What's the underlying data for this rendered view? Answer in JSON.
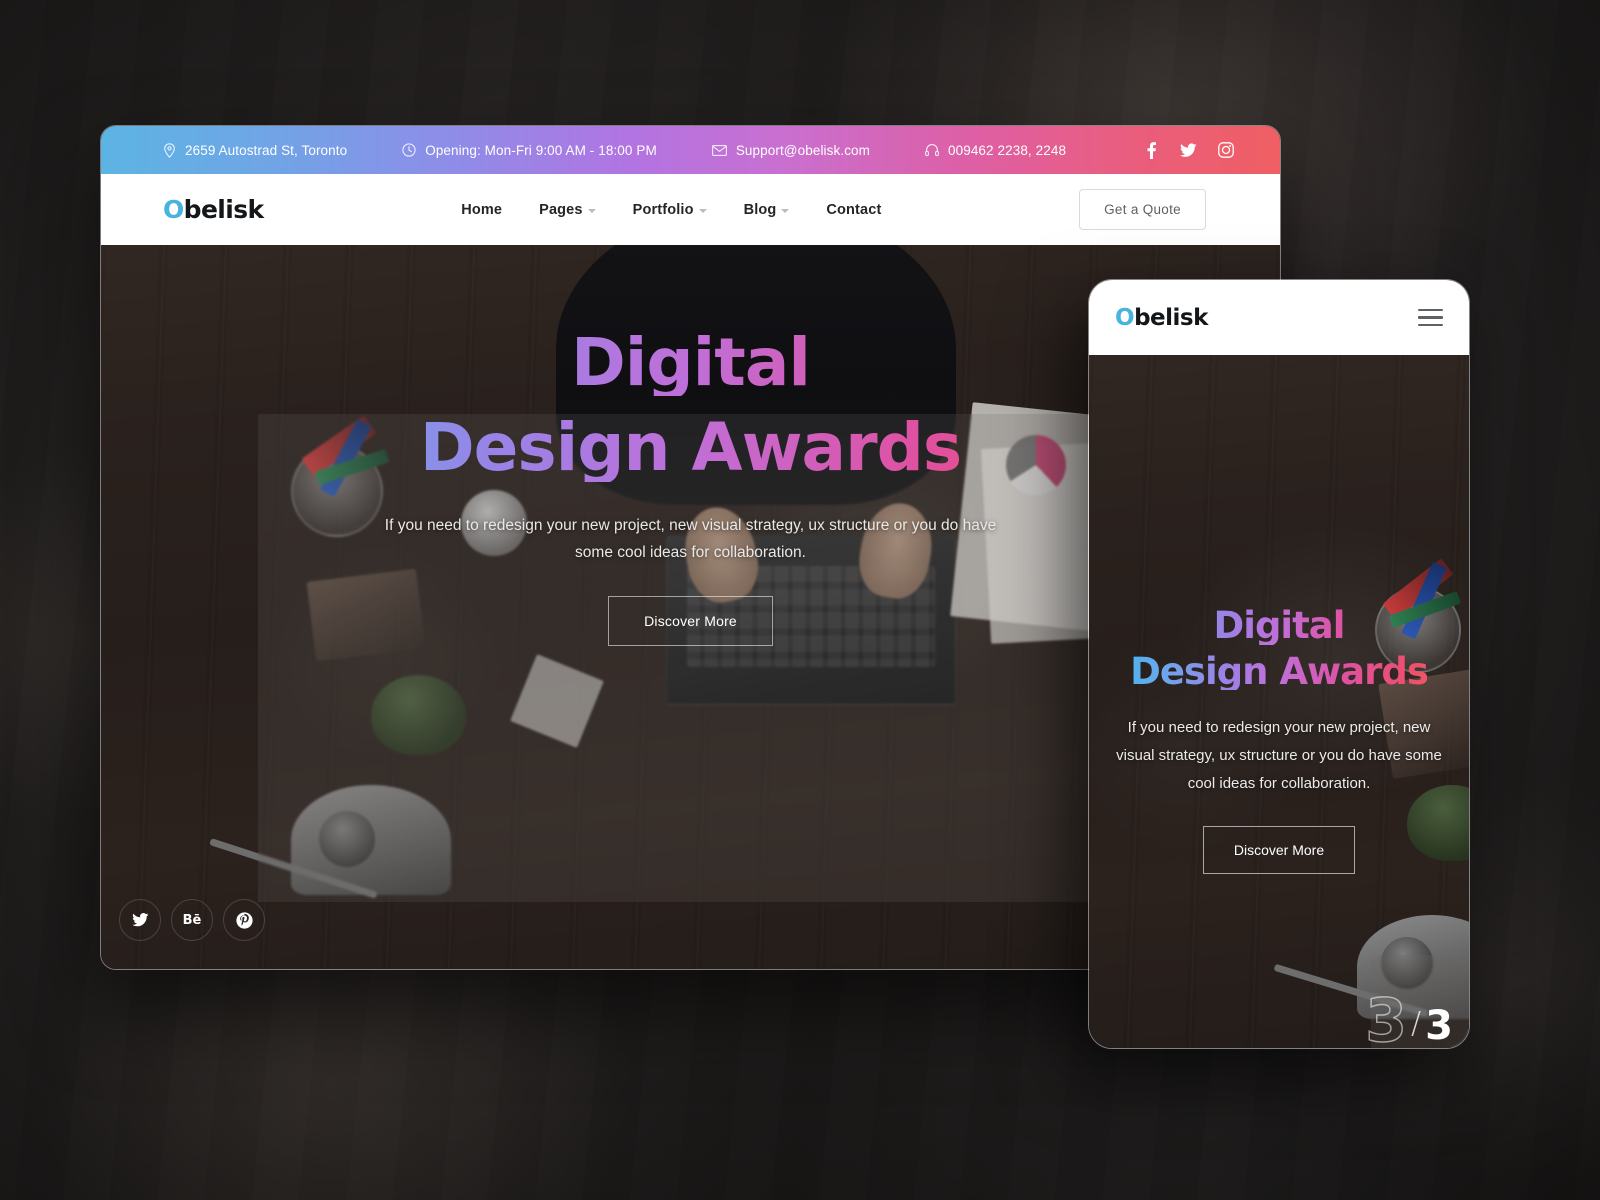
{
  "topbar": {
    "address": "2659 Autostrad St, Toronto",
    "hours": "Opening: Mon-Fri 9:00 AM - 18:00 PM",
    "email": "Support@obelisk.com",
    "phone": "009462 2238, 2248",
    "social": [
      "facebook-icon",
      "twitter-icon",
      "instagram-icon"
    ],
    "gradient_start": "#5cb4e4",
    "gradient_mid": "#b274e2",
    "gradient_end": "#ef5f63"
  },
  "nav": {
    "logo_first": "O",
    "logo_rest": "belisk",
    "logo_accent": "#49b3e0",
    "items": [
      {
        "label": "Home",
        "has_dropdown": false
      },
      {
        "label": "Pages",
        "has_dropdown": true
      },
      {
        "label": "Portfolio",
        "has_dropdown": true
      },
      {
        "label": "Blog",
        "has_dropdown": true
      },
      {
        "label": "Contact",
        "has_dropdown": false
      }
    ],
    "cta_label": "Get a Quote"
  },
  "hero": {
    "heading_line1": "Digital",
    "heading_line2": "Design Awards",
    "subtitle": "If you need to redesign your new project, new visual strategy, ux structure or you do have some cool ideas for collaboration.",
    "button_label": "Discover More",
    "heading_gradient_start": "#3fb8ef",
    "heading_gradient_mid": "#c06fd8",
    "heading_gradient_end": "#ef5b5b",
    "socials": [
      "twitter-icon",
      "behance-icon",
      "pinterest-icon"
    ],
    "behance_label": "Bē"
  },
  "mobile": {
    "logo_first": "O",
    "logo_rest": "belisk",
    "menu_icon": "hamburger-menu-icon",
    "heading_line1": "Digital",
    "heading_line2": "Design Awards",
    "subtitle": "If you need to redesign your new project, new visual strategy, ux structure or you do have some cool ideas for collaboration.",
    "button_label": "Discover More",
    "slide_current": "3",
    "slide_separator": "/",
    "slide_total": "3"
  }
}
